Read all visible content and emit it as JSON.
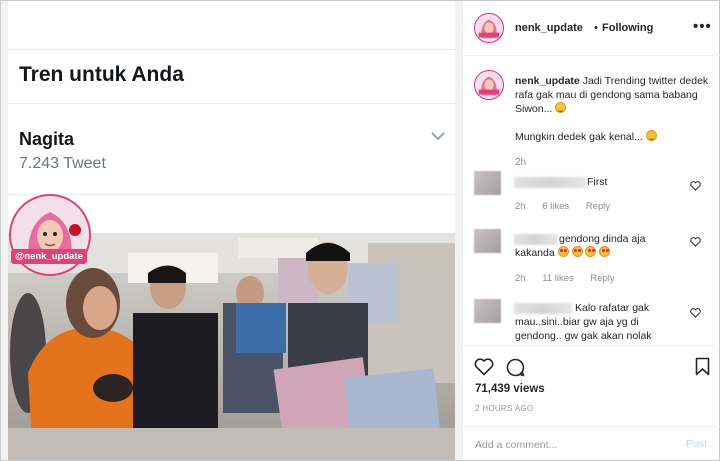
{
  "trend": {
    "heading": "Tren untuk Anda",
    "name": "Nagita",
    "count": "7.243 Tweet"
  },
  "watermark": {
    "handle": "@nenk_update"
  },
  "header": {
    "username": "nenk_update",
    "separator": "•",
    "follow_status": "Following",
    "more": "•••"
  },
  "caption": {
    "username": "nenk_update",
    "text": "Jadi Trending twitter dedek rafa gak mau di gendong sama babang Siwon...",
    "text2": "Mungkin dedek gak kenal...",
    "time": "2h"
  },
  "comments": [
    {
      "text": "First",
      "time": "2h",
      "likes": "6 likes",
      "reply": "Reply"
    },
    {
      "text": "gendong dinda aja kakanda",
      "time": "2h",
      "likes": "11 likes",
      "reply": "Reply"
    },
    {
      "text": "Kalo rafatar gak mau..sini..biar gw aja yg di gendong.. gw gak akan nolak",
      "time": "",
      "likes": "",
      "reply": ""
    }
  ],
  "actions": {
    "views": "71,439 views",
    "ago": "2 HOURS AGO",
    "add_comment_placeholder": "Add a comment...",
    "post_label": "Post"
  },
  "colors": {
    "link_blue": "#b2dffc",
    "avatar_ring": "#d6249f",
    "muted_text": "#8e8e8e"
  }
}
